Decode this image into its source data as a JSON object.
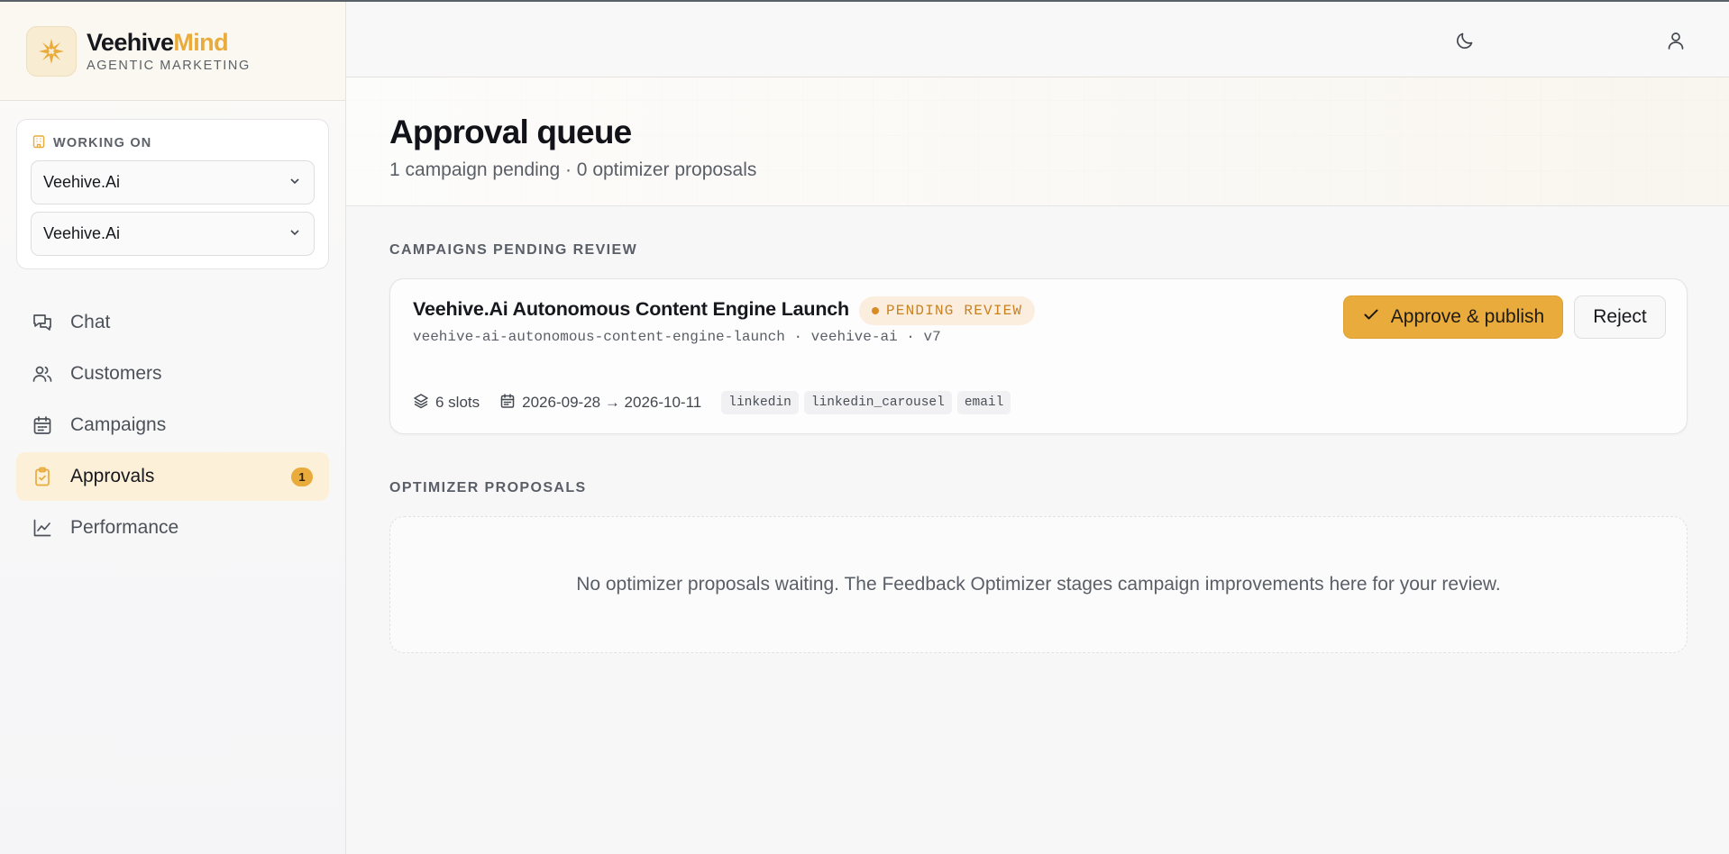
{
  "brand": {
    "name_primary": "Veehive",
    "name_accent": "Mind",
    "subtitle": "AGENTIC MARKETING",
    "accent_color": "#e9ab3c"
  },
  "working_on": {
    "label": "WORKING ON",
    "select_1": "Veehive.Ai",
    "select_2": "Veehive.Ai"
  },
  "nav": {
    "items": [
      {
        "label": "Chat",
        "icon": "chat-icon"
      },
      {
        "label": "Customers",
        "icon": "users-icon"
      },
      {
        "label": "Campaigns",
        "icon": "calendar-icon"
      },
      {
        "label": "Approvals",
        "icon": "clipboard-check-icon",
        "active": true,
        "badge": "1"
      },
      {
        "label": "Performance",
        "icon": "line-chart-icon"
      }
    ]
  },
  "topbar": {
    "theme_icon": "moon-icon",
    "user_icon": "user-icon"
  },
  "page": {
    "title": "Approval queue",
    "subtitle": "1 campaign pending · 0 optimizer proposals"
  },
  "campaigns_section": {
    "label": "CAMPAIGNS PENDING REVIEW",
    "campaign": {
      "title": "Veehive.Ai Autonomous Content Engine Launch",
      "status": "PENDING REVIEW",
      "meta": "veehive-ai-autonomous-content-engine-launch · veehive-ai · v7",
      "slots": "6 slots",
      "date_range": "2026-09-28 → 2026-10-11",
      "tags": [
        "linkedin",
        "linkedin_carousel",
        "email"
      ],
      "approve_label": "Approve & publish",
      "reject_label": "Reject"
    }
  },
  "optimizer_section": {
    "label": "OPTIMIZER PROPOSALS",
    "empty_text": "No optimizer proposals waiting. The Feedback Optimizer stages campaign improvements here for your review."
  }
}
